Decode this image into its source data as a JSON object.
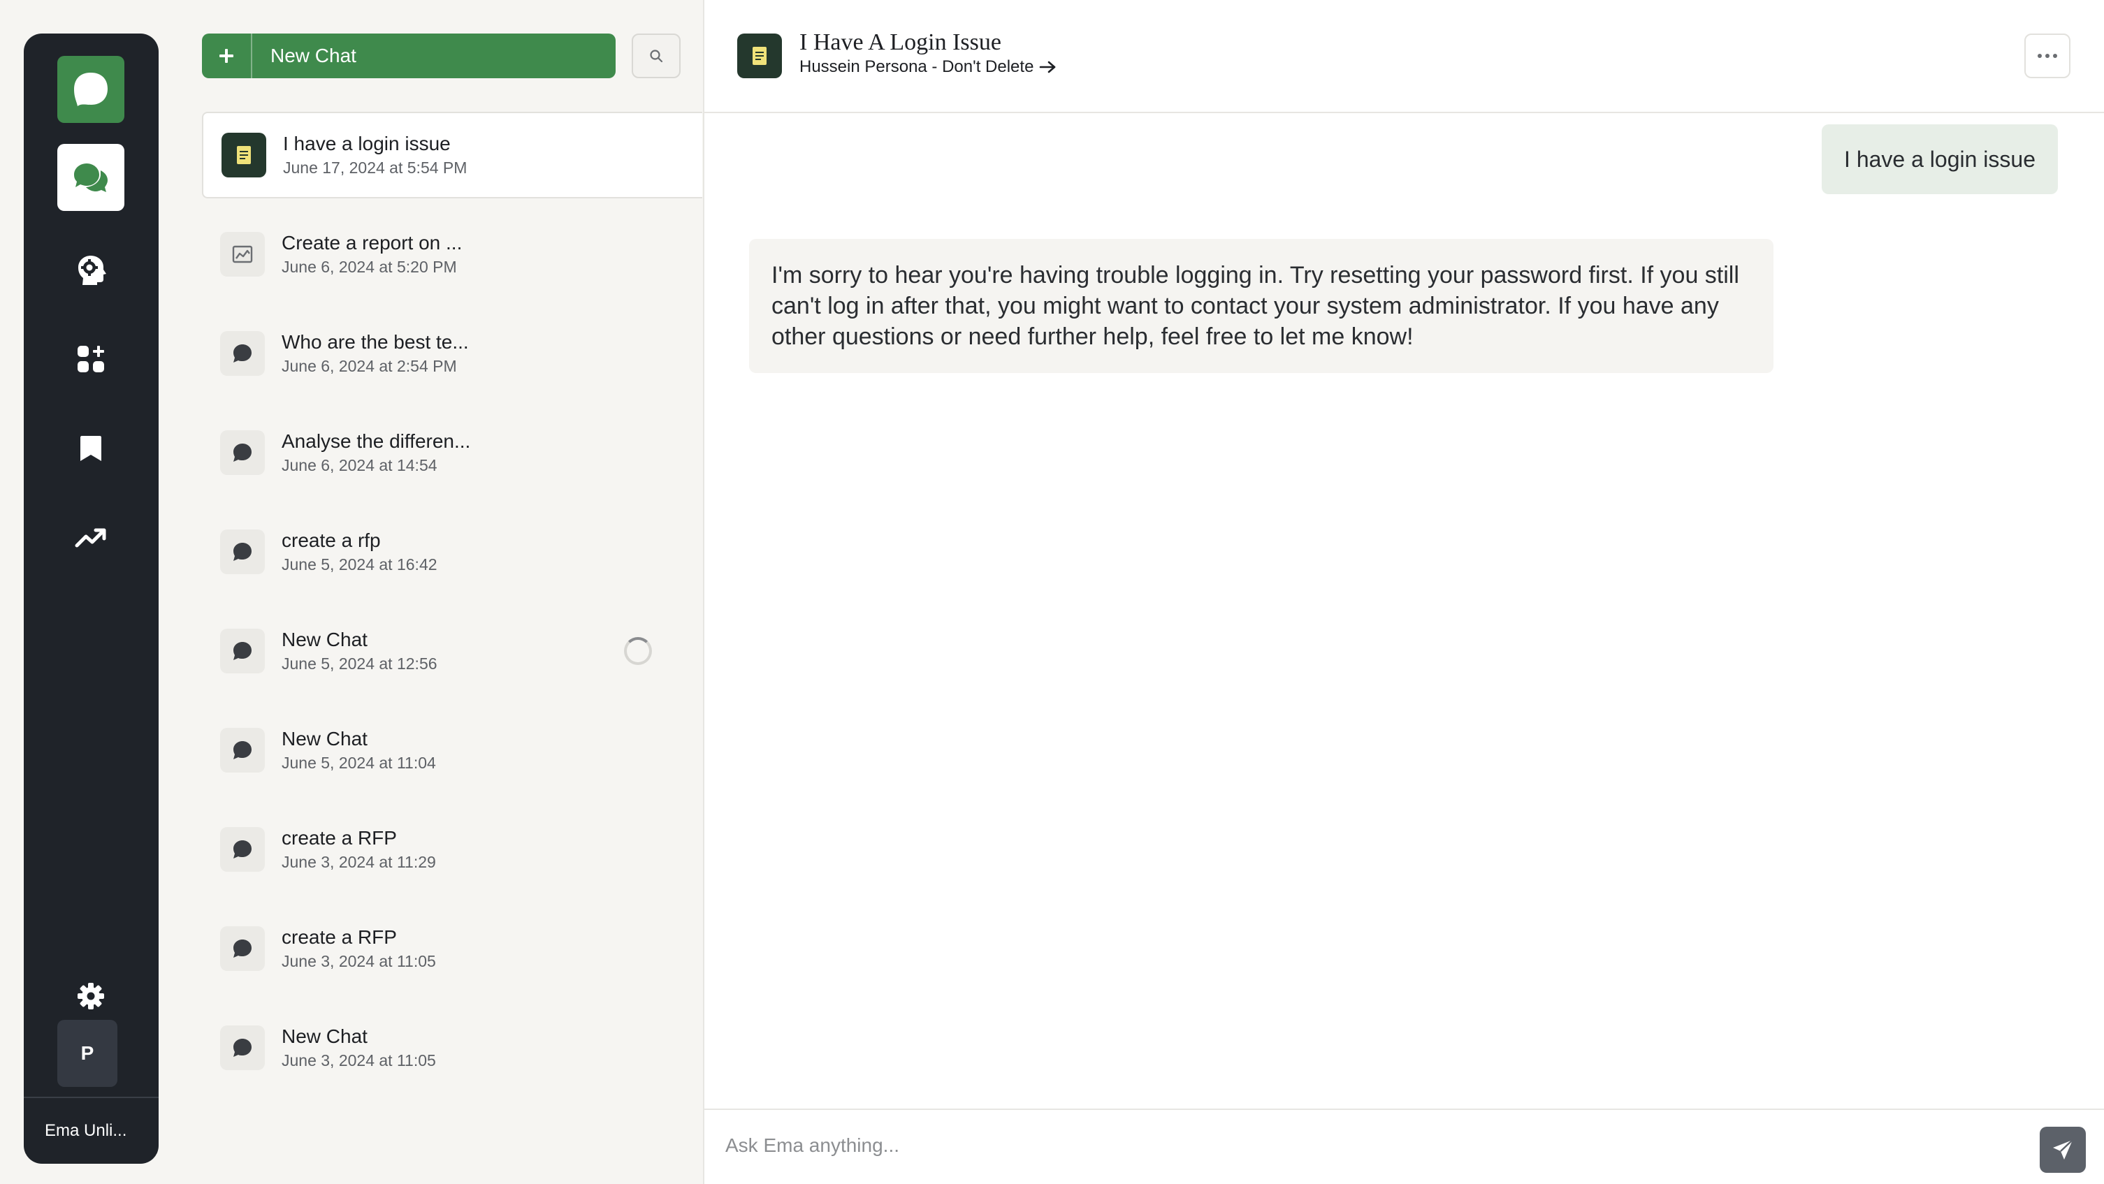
{
  "rail": {
    "items": [
      {
        "icon": "ema-logo-icon"
      },
      {
        "icon": "chat-bubbles-icon",
        "active": true
      },
      {
        "icon": "bot-gear-icon"
      },
      {
        "icon": "apps-grid-icon"
      },
      {
        "icon": "bookmark-icon"
      },
      {
        "icon": "trending-icon"
      }
    ],
    "settings_icon": "gear-icon",
    "avatar_initial": "P",
    "workspace_label": "Ema Unli..."
  },
  "chat_list": {
    "new_chat_label": "New Chat",
    "search_icon": "search-icon",
    "items": [
      {
        "title": "I have a login issue",
        "date": "June 17, 2024 at 5:54 PM",
        "icon": "document-icon",
        "active": true
      },
      {
        "title": "Create a report on ...",
        "date": "June 6, 2024 at 5:20 PM",
        "icon": "chart-image-icon"
      },
      {
        "title": "Who are the best te...",
        "date": "June 6, 2024 at 2:54 PM",
        "icon": "chat-bubble-icon"
      },
      {
        "title": "Analyse the differen...",
        "date": "June 6, 2024 at 14:54",
        "icon": "chat-bubble-icon"
      },
      {
        "title": "create a rfp",
        "date": "June 5, 2024 at 16:42",
        "icon": "chat-bubble-icon"
      },
      {
        "title": "New Chat",
        "date": "June 5, 2024 at 12:56",
        "icon": "chat-bubble-icon",
        "loading": true
      },
      {
        "title": "New Chat",
        "date": "June 5, 2024 at 11:04",
        "icon": "chat-bubble-icon"
      },
      {
        "title": "create a RFP",
        "date": "June 3, 2024 at 11:29",
        "icon": "chat-bubble-icon"
      },
      {
        "title": "create a RFP",
        "date": "June 3, 2024 at 11:05",
        "icon": "chat-bubble-icon"
      },
      {
        "title": "New Chat",
        "date": "June 3, 2024 at 11:05",
        "icon": "chat-bubble-icon"
      }
    ]
  },
  "conversation": {
    "title": "I Have A Login Issue",
    "persona": "Hussein Persona - Don't Delete",
    "more_icon": "more-horizontal-icon",
    "messages": [
      {
        "role": "user",
        "text": "I have a login issue"
      },
      {
        "role": "assistant",
        "text": "I'm sorry to hear you're having trouble logging in. Try resetting your password first. If you still can't log in after that, you might want to contact your system administrator. If you have any other questions or need further help, feel free to let me know!"
      }
    ],
    "composer_placeholder": "Ask Ema anything...",
    "send_icon": "send-icon"
  },
  "colors": {
    "accent_green": "#3f8a4c",
    "rail_bg": "#1f2329",
    "dark_green_icon": "#24382d",
    "user_bubble": "#e7eee7",
    "bot_bubble": "#f5f4f1"
  }
}
